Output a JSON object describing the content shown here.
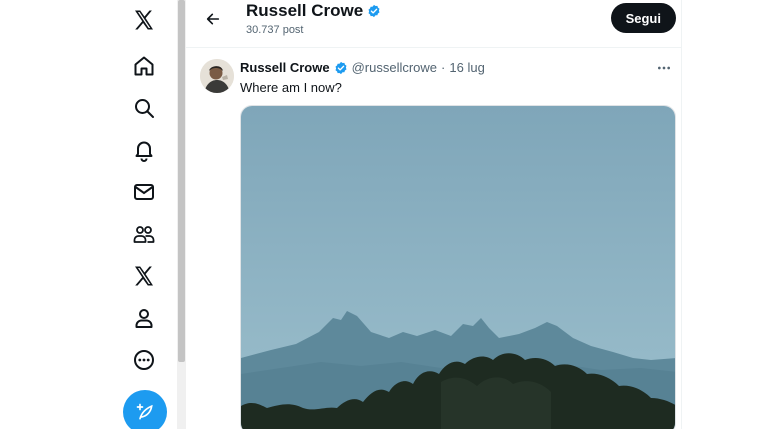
{
  "sidebar": {
    "items": [
      {
        "icon": "x-logo-icon",
        "label": "X"
      },
      {
        "icon": "home-icon",
        "label": "Home"
      },
      {
        "icon": "search-icon",
        "label": "Search"
      },
      {
        "icon": "bell-icon",
        "label": "Notifications"
      },
      {
        "icon": "mail-icon",
        "label": "Messages"
      },
      {
        "icon": "communities-icon",
        "label": "Communities"
      },
      {
        "icon": "x-premium-icon",
        "label": "Premium"
      },
      {
        "icon": "profile-icon",
        "label": "Profile"
      },
      {
        "icon": "more-circle-icon",
        "label": "More"
      }
    ],
    "compose_icon": "feather-plus-icon"
  },
  "header": {
    "name": "Russell Crowe",
    "post_count": "30.737 post",
    "follow_label": "Segui",
    "back_icon": "arrow-left-icon"
  },
  "post": {
    "author": "Russell Crowe",
    "handle": "@russellcrowe",
    "separator": "·",
    "date": "16 lug",
    "text": "Where am I now?",
    "media_icon": "landscape-photo",
    "more_icon": "more-horizontal-icon"
  },
  "colors": {
    "accent": "#1d9bf0",
    "text": "#0f1419",
    "secondary": "#536471",
    "sky": "#88aec2",
    "mountain": "#5a8496",
    "trees": "#1f2d22"
  }
}
